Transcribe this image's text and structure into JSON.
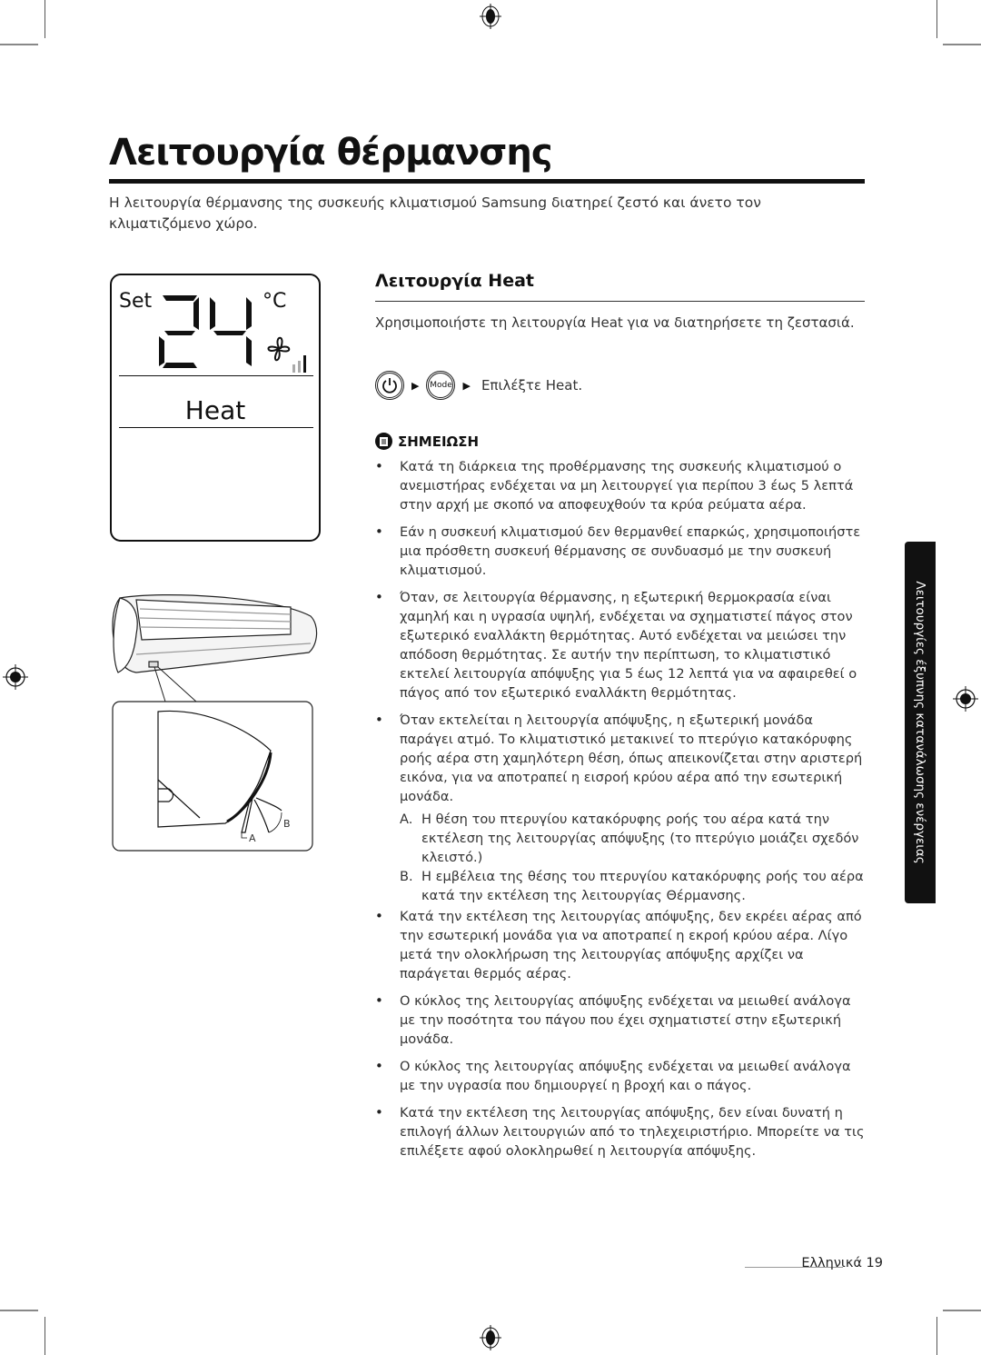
{
  "page": {
    "title": "Λειτουργία θέρμανσης",
    "intro": "Η λειτουργία θέρμανσης της συσκευής κλιματισμού Samsung διατηρεί ζεστό και άνετο τον κλιματιζόμενο χώρο."
  },
  "lcd_display": {
    "set_label": "Set",
    "temperature": "24",
    "unit": "°C",
    "fan_icon": "fan-icon",
    "fan_speed_bars_active": 1,
    "fan_speed_bars_total": 3,
    "mode": "Heat"
  },
  "section": {
    "heading": "Λειτουργία Heat",
    "description": "Χρησιμοποιήστε τη λειτουργία Heat για να διατηρήσετε τη ζεστασιά.",
    "steps": {
      "power_icon": "power-icon",
      "arrow": "▶",
      "mode_button": "Mode",
      "final_text": "Επιλέξτε Heat."
    }
  },
  "note": {
    "icon": "note-icon",
    "label": "ΣΗΜΕΙΩΣΗ",
    "bullets": [
      "Κατά τη διάρκεια της προθέρμανσης της συσκευής κλιματισμού ο ανεμιστήρας ενδέχεται να μη λειτουργεί για περίπου 3 έως 5 λεπτά στην αρχή με σκοπό να αποφευχθούν τα κρύα ρεύματα αέρα.",
      "Εάν η συσκευή κλιματισμού δεν θερμανθεί επαρκώς, χρησιμοποιήστε μια πρόσθετη συσκευή θέρμανσης σε συνδυασμό με την συσκευή κλιματισμού.",
      "Όταν, σε λειτουργία θέρμανσης, η εξωτερική θερμοκρασία είναι χαμηλή και η υγρασία υψηλή, ενδέχεται να σχηματιστεί πάγος στον εξωτερικό εναλλάκτη θερμότητας. Αυτό ενδέχεται να μειώσει την απόδοση θερμότητας. Σε αυτήν την περίπτωση, το κλιματιστικό εκτελεί λειτουργία απόψυξης για 5 έως 12 λεπτά για να αφαιρεθεί ο πάγος από τον εξωτερικό εναλλάκτη θερμότητας.",
      "Όταν εκτελείται η λειτουργία απόψυξης, η εξωτερική μονάδα παράγει ατμό. Το κλιματιστικό μετακινεί το πτερύγιο κατακόρυφης ροής αέρα στη χαμηλότερη θέση, όπως απεικονίζεται στην αριστερή εικόνα, για να αποτραπεί η εισροή κρύου αέρα από την εσωτερική μονάδα.",
      "Κατά την εκτέλεση της λειτουργίας απόψυξης, δεν εκρέει αέρας από την εσωτερική μονάδα για να αποτραπεί η εκροή κρύου αέρα. Λίγο μετά την ολοκλήρωση της λειτουργίας απόψυξης αρχίζει να παράγεται θερμός αέρας.",
      "Ο κύκλος της λειτουργίας απόψυξης ενδέχεται να μειωθεί ανάλογα με την ποσότητα του πάγου που έχει σχηματιστεί στην εξωτερική μονάδα.",
      "Ο κύκλος της λειτουργίας απόψυξης ενδέχεται να μειωθεί ανάλογα με την υγρασία που δημιουργεί η βροχή και ο πάγος.",
      "Κατά την εκτέλεση της λειτουργίας απόψυξης, δεν είναι δυνατή η επιλογή άλλων λειτουργιών από το τηλεχειριστήριο. Μπορείτε να τις επιλέξετε αφού ολοκληρωθεί η λειτουργία απόψυξης."
    ],
    "sub_items": [
      {
        "label": "A.",
        "text": "Η θέση του πτερυγίου κατακόρυφης ροής του αέρα κατά την εκτέλεση της λειτουργίας απόψυξης (το πτερύγιο μοιάζει σχεδόν κλειστό.)"
      },
      {
        "label": "B.",
        "text": "Η εμβέλεια της θέσης του πτερυγίου κατακόρυφης ροής του αέρα κατά την εκτέλεση της λειτουργίας Θέρμανσης."
      }
    ]
  },
  "illustration": {
    "label_a": "A",
    "label_b": "B"
  },
  "side_tab": {
    "text": "Λειτουργίες έξυπνης κατανάλωσης ενέργειας"
  },
  "footer": {
    "language": "Ελληνικά",
    "page_number": "19"
  }
}
